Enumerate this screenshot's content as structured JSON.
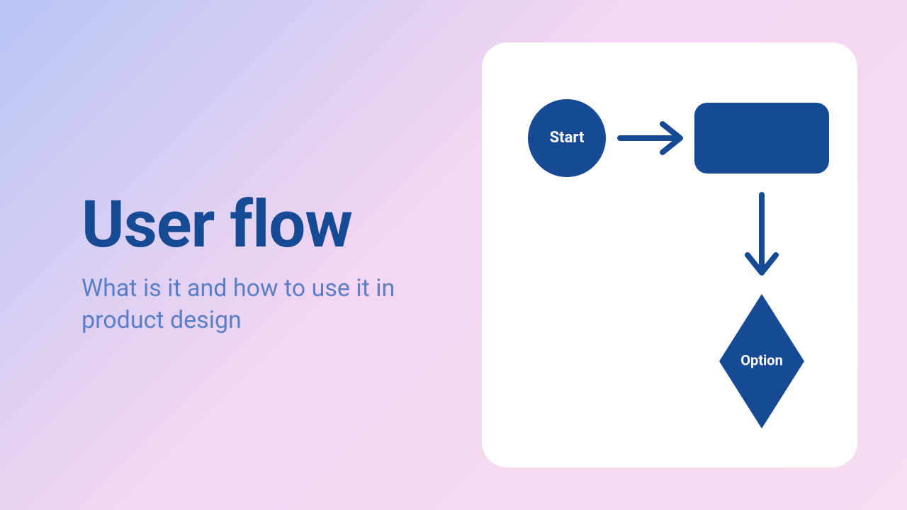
{
  "title": "User flow",
  "subtitle": "What is it and how to use it in product design",
  "diagram": {
    "start_label": "Start",
    "decision_label": "Option"
  },
  "colors": {
    "primary": "#164a94",
    "subtitle": "#5b7fc7",
    "card_bg": "#ffffff"
  }
}
